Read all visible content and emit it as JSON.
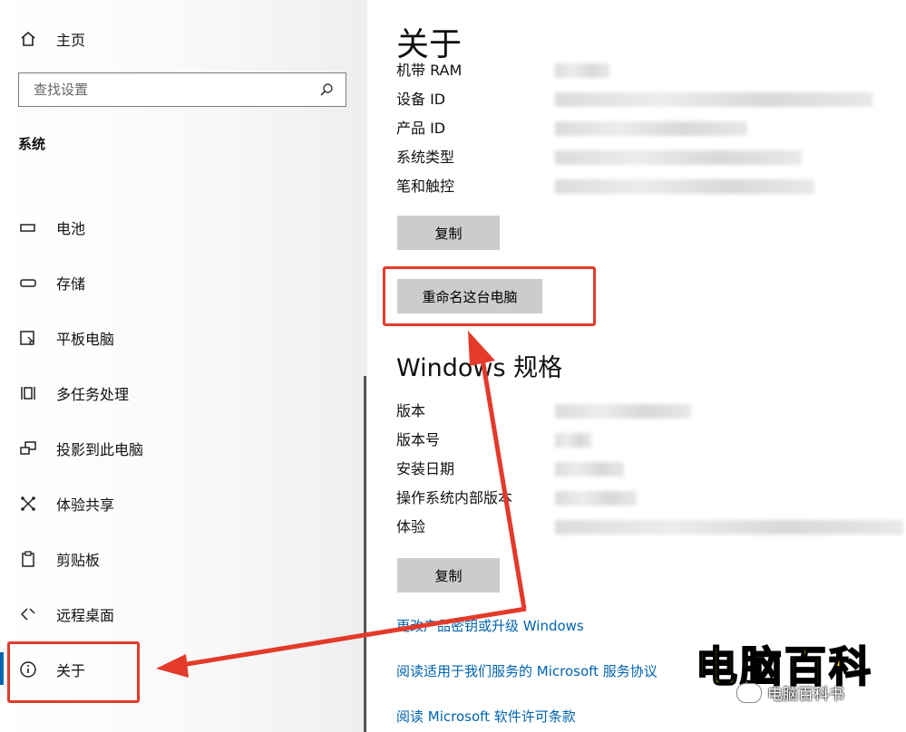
{
  "sidebar": {
    "home_label": "主页",
    "search_placeholder": "查找设置",
    "section_title": "系统",
    "items": [
      {
        "label": "电池",
        "icon": "battery-icon"
      },
      {
        "label": "存储",
        "icon": "storage-icon"
      },
      {
        "label": "平板电脑",
        "icon": "tablet-icon"
      },
      {
        "label": "多任务处理",
        "icon": "multitask-icon"
      },
      {
        "label": "投影到此电脑",
        "icon": "project-icon"
      },
      {
        "label": "体验共享",
        "icon": "share-icon"
      },
      {
        "label": "剪贴板",
        "icon": "clipboard-icon"
      },
      {
        "label": "远程桌面",
        "icon": "remote-desktop-icon"
      },
      {
        "label": "关于",
        "icon": "info-icon",
        "active": true
      }
    ]
  },
  "main": {
    "title": "关于",
    "device_specs": [
      "机带 RAM",
      "设备 ID",
      "产品 ID",
      "系统类型",
      "笔和触控"
    ],
    "copy_button": "复制",
    "rename_button": "重命名这台电脑",
    "windows_title": "Windows 规格",
    "windows_specs": [
      "版本",
      "版本号",
      "安装日期",
      "操作系统内部版本",
      "体验"
    ],
    "copy_button2": "复制",
    "links": [
      "更改产品密钥或升级 Windows",
      "阅读适用于我们服务的 Microsoft 服务协议",
      "阅读 Microsoft 软件许可条款"
    ]
  },
  "watermark": {
    "title": "电脑百科",
    "subtitle": "电脑百科书"
  },
  "colors": {
    "accent": "#0063b1",
    "highlight": "#e43a2a",
    "watermark": "#ffe600"
  }
}
